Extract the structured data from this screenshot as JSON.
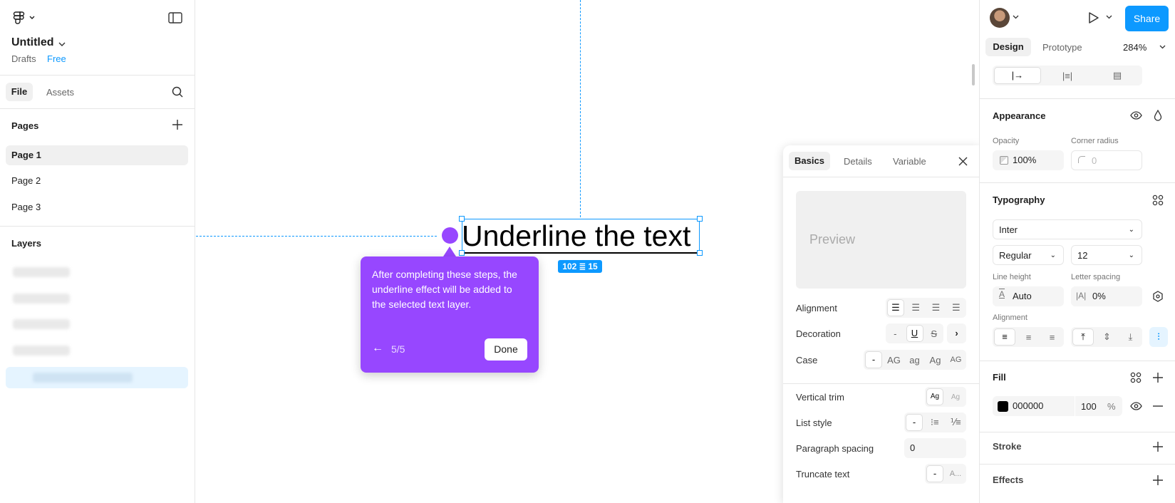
{
  "left": {
    "file_title": "Untitled",
    "drafts": "Drafts",
    "plan": "Free",
    "tabs": [
      "File",
      "Assets"
    ],
    "pages_title": "Pages",
    "pages": [
      "Page 1",
      "Page 2",
      "Page 3"
    ],
    "layers_title": "Layers"
  },
  "canvas": {
    "text_layer": "Underline the text",
    "size_badge_w": "102",
    "size_badge_h": "15",
    "tooltip": {
      "body": "After completing these steps, the underline effect will be added to the selected text layer.",
      "step": "5/5",
      "done_label": "Done"
    }
  },
  "text_panel": {
    "tabs": [
      "Basics",
      "Details",
      "Variable"
    ],
    "preview": "Preview",
    "alignment": "Alignment",
    "decoration": "Decoration",
    "decoration_none": "-",
    "decoration_underline": "U",
    "decoration_strike": "S",
    "case": "Case",
    "case_options": [
      "-",
      "AG",
      "ag",
      "Ag",
      "AG"
    ],
    "vertical_trim": "Vertical trim",
    "trim_option": "Ag",
    "list_style": "List style",
    "list_none": "-",
    "paragraph_spacing": "Paragraph spacing",
    "paragraph_value": "0",
    "truncate_text": "Truncate text",
    "truncate_none": "-",
    "truncate_ellipsis": "A..."
  },
  "right": {
    "share_label": "Share",
    "tabs": [
      "Design",
      "Prototype"
    ],
    "zoom": "284%",
    "appearance_title": "Appearance",
    "opacity_label": "Opacity",
    "opacity_value": "100%",
    "corner_label": "Corner radius",
    "corner_value": "0",
    "typography_title": "Typography",
    "font_family": "Inter",
    "font_weight": "Regular",
    "font_size": "12",
    "line_height_label": "Line height",
    "line_height_value": "Auto",
    "letter_spacing_label": "Letter spacing",
    "letter_spacing_value": "0%",
    "alignment_label": "Alignment",
    "fill_title": "Fill",
    "fill_hex": "000000",
    "fill_opacity": "100",
    "fill_pct": "%",
    "stroke_title": "Stroke",
    "effects_title": "Effects"
  },
  "colors": {
    "accent": "#0d99ff",
    "tooltip": "#9747ff",
    "fill": "#000000"
  }
}
